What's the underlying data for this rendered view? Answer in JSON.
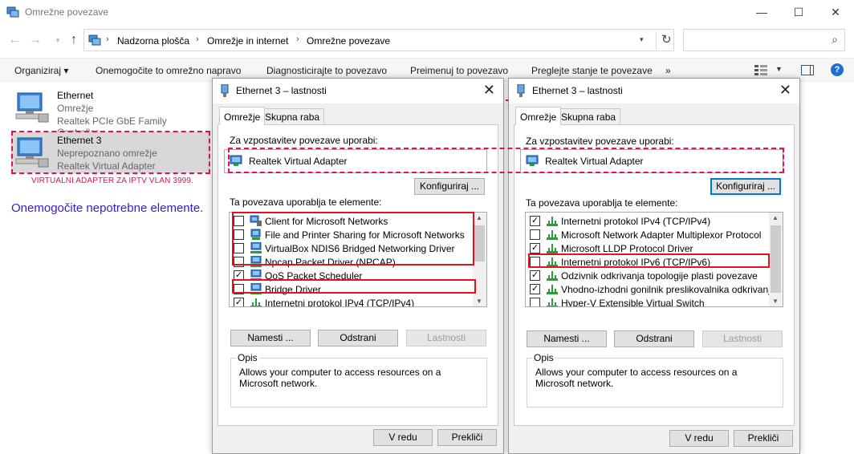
{
  "window": {
    "title": "Omrežne povezave"
  },
  "address": {
    "crumbs": [
      "Nadzorna plošča",
      "Omrežje in internet",
      "Omrežne povezave"
    ],
    "search_placeholder": ""
  },
  "toolbar": {
    "organize": "Organiziraj ▾",
    "disable": "Onemogočite to omrežno napravo",
    "diagnose": "Diagnosticirajte to povezavo",
    "rename": "Preimenuj to povezavo",
    "status": "Preglejte stanje te povezave",
    "more": "»"
  },
  "connections": [
    {
      "name": "Ethernet",
      "status": "Omrežje",
      "device": "Realtek PCIe GbE Family Controller"
    },
    {
      "name": "Ethernet 3",
      "status": "Neprepoznano omrežje",
      "device": "Realtek Virtual Adapter"
    }
  ],
  "annotations": {
    "red_note": "VIRTUALNI ADAPTER ZA IPTV VLAN 3999.",
    "blue_note": "Onemogočite nepotrebne elemente."
  },
  "dialog": {
    "title": "Ethernet 3 – lastnosti",
    "tabs": [
      "Omrežje",
      "Skupna raba"
    ],
    "connect_using_label": "Za vzpostavitev povezave uporabi:",
    "adapter": "Realtek Virtual Adapter",
    "configure": "Konfiguriraj ...",
    "items_label": "Ta povezava uporablja te elemente:",
    "install": "Namesti ...",
    "uninstall": "Odstrani",
    "properties": "Lastnosti",
    "desc_label": "Opis",
    "description": "Allows your computer to access resources on a Microsoft network.",
    "ok": "V redu",
    "cancel": "Prekliči"
  },
  "dialog_left_items": [
    {
      "label": "Client for Microsoft Networks",
      "checked": false,
      "icon": "client-icon"
    },
    {
      "label": "File and Printer Sharing for Microsoft Networks",
      "checked": false,
      "icon": "service-icon"
    },
    {
      "label": "VirtualBox NDIS6 Bridged Networking Driver",
      "checked": false,
      "icon": "network-icon"
    },
    {
      "label": "Npcap Packet Driver (NPCAP)",
      "checked": false,
      "icon": "network-icon"
    },
    {
      "label": "QoS Packet Scheduler",
      "checked": true,
      "icon": "network-icon"
    },
    {
      "label": "Bridge Driver",
      "checked": false,
      "icon": "network-icon"
    },
    {
      "label": "Internetni protokol IPv4 (TCP/IPv4)",
      "checked": true,
      "icon": "protocol-icon"
    }
  ],
  "dialog_right_items": [
    {
      "label": "Internetni protokol IPv4 (TCP/IPv4)",
      "checked": true,
      "icon": "protocol-icon"
    },
    {
      "label": "Microsoft Network Adapter Multiplexor Protocol",
      "checked": false,
      "icon": "protocol-icon"
    },
    {
      "label": "Microsoft LLDP Protocol Driver",
      "checked": true,
      "icon": "protocol-icon"
    },
    {
      "label": "Internetni protokol IPv6 (TCP/IPv6)",
      "checked": false,
      "icon": "protocol-icon"
    },
    {
      "label": "Odzivnik odkrivanja topologije plasti povezave",
      "checked": true,
      "icon": "protocol-icon"
    },
    {
      "label": "Vhodno-izhodni gonilnik preslikovalnika odkrivanja topc",
      "checked": true,
      "icon": "protocol-icon"
    },
    {
      "label": "Hyper-V Extensible Virtual Switch",
      "checked": false,
      "icon": "protocol-icon"
    }
  ],
  "colors": {
    "annotation_pink": "#e0115f",
    "highlight_red": "#e0141e",
    "note_blue": "#3a18d8",
    "selection_gray": "#d8d8d8"
  }
}
